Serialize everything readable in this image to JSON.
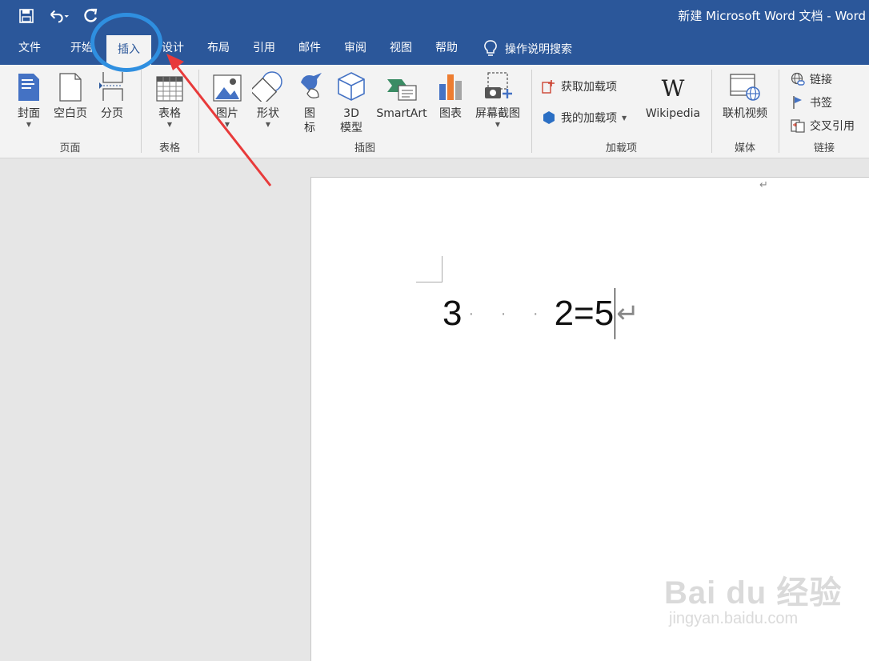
{
  "title": "新建 Microsoft Word 文档  -  Word",
  "qat": {
    "save_icon": "save-icon",
    "undo_icon": "undo-icon",
    "redo_icon": "redo-icon"
  },
  "tabs": [
    {
      "id": "file",
      "label": "文件"
    },
    {
      "id": "home",
      "label": "开始"
    },
    {
      "id": "insert",
      "label": "插入",
      "active": true
    },
    {
      "id": "design",
      "label": "设计"
    },
    {
      "id": "layout",
      "label": "布局"
    },
    {
      "id": "references",
      "label": "引用"
    },
    {
      "id": "mailings",
      "label": "邮件"
    },
    {
      "id": "review",
      "label": "审阅"
    },
    {
      "id": "view",
      "label": "视图"
    },
    {
      "id": "help",
      "label": "帮助"
    }
  ],
  "tell_me": "操作说明搜索",
  "ribbon": {
    "pages": {
      "label": "页面",
      "cover": "封面",
      "blank": "空白页",
      "break": "分页"
    },
    "tables": {
      "label": "表格",
      "table": "表格"
    },
    "illustrations": {
      "label": "插图",
      "pictures": "图片",
      "shapes": "形状",
      "icons_1": "图",
      "icons_2": "标",
      "model_1": "3D",
      "model_2": "模型",
      "smartart": "SmartArt",
      "chart": "图表",
      "screenshot": "屏幕截图"
    },
    "addins": {
      "label": "加载项",
      "get": "获取加载项",
      "my": "我的加载项",
      "wikipedia": "Wikipedia"
    },
    "media": {
      "label": "媒体",
      "online_video": "联机视频"
    },
    "links": {
      "label": "链接",
      "link": "链接",
      "bookmark": "书签",
      "cross_ref": "交叉引用"
    }
  },
  "document": {
    "eq_left": "3",
    "eq_dots": "· · ·",
    "eq_right": "2=5",
    "return_mark": "↵"
  },
  "watermark": {
    "big": "Bai du 经验",
    "small": "jingyan.baidu.com"
  },
  "colors": {
    "word_blue": "#2b579a",
    "annotation_blue": "#2f8fe0",
    "annotation_red": "#e83a3a"
  }
}
